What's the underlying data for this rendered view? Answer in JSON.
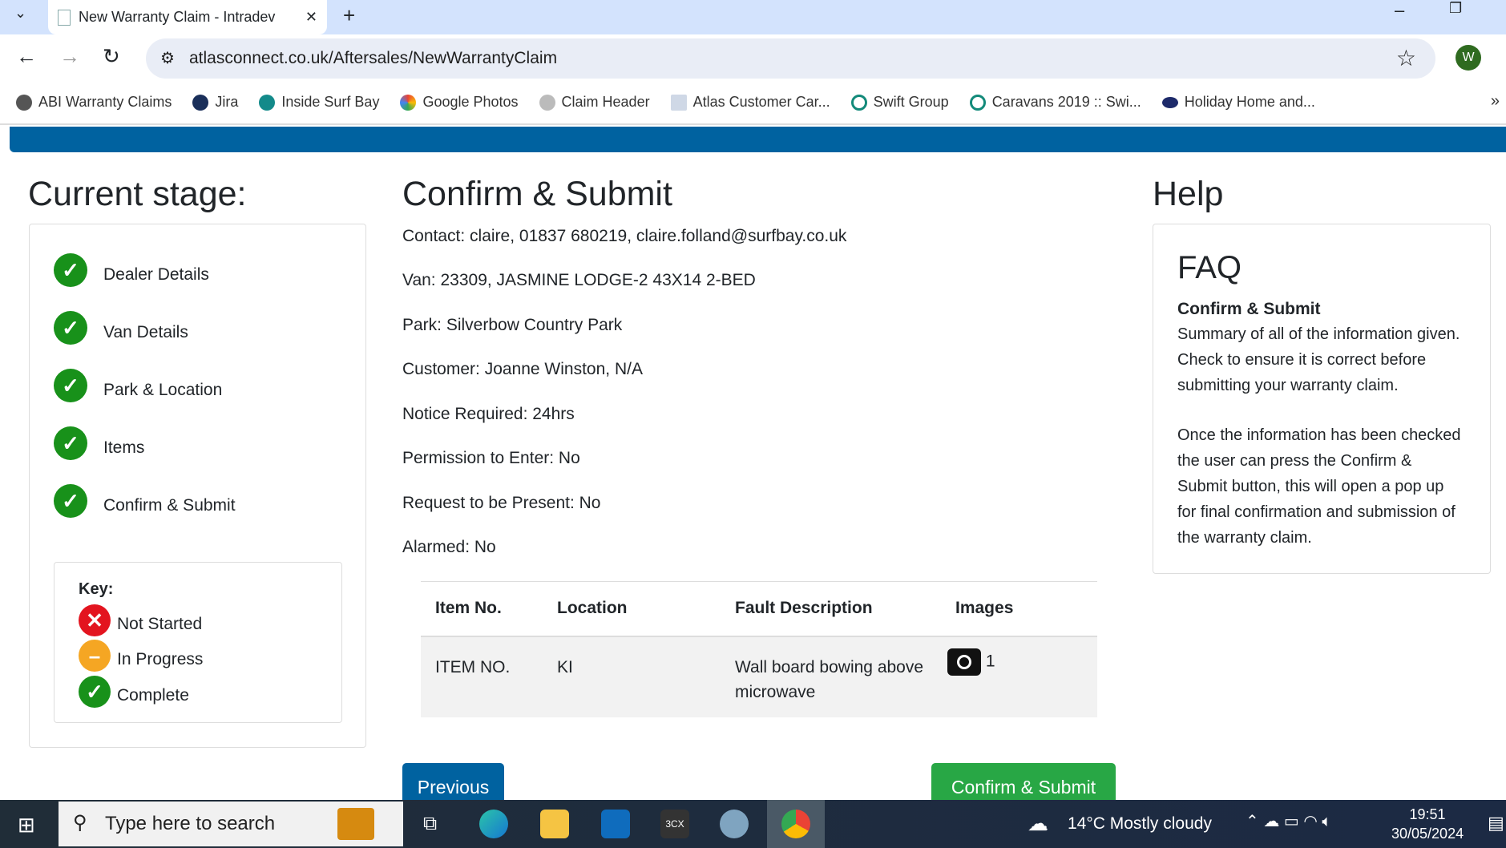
{
  "browser": {
    "tab_title": "New Warranty Claim - Intradev",
    "url": "atlasconnect.co.uk/Aftersales/NewWarrantyClaim",
    "profile_initial": "W",
    "bookmarks": [
      "ABI Warranty Claims",
      "Jira",
      "Inside Surf Bay",
      "Google Photos",
      "Claim Header",
      "Atlas Customer Car...",
      "Swift Group",
      "Caravans 2019 :: Swi...",
      "Holiday Home and..."
    ]
  },
  "stage": {
    "title": "Current stage:",
    "steps": [
      "Dealer Details",
      "Van Details",
      "Park & Location",
      "Items",
      "Confirm & Submit"
    ],
    "key": {
      "title": "Key:",
      "not_started": "Not Started",
      "in_progress": "In Progress",
      "complete": "Complete"
    }
  },
  "main": {
    "title": "Confirm & Submit",
    "lines": [
      "Contact: claire, 01837 680219, claire.folland@surfbay.co.uk",
      "Van: 23309, JASMINE LODGE-2 43X14 2-BED",
      "Park: Silverbow Country Park",
      "Customer: Joanne Winston, N/A",
      "Notice Required: 24hrs",
      "Permission to Enter: No",
      "Request to be Present: No",
      "Alarmed: No"
    ],
    "table": {
      "headers": [
        "Item No.",
        "Location",
        "Fault Description",
        "Images"
      ],
      "rows": [
        {
          "item": "ITEM NO.",
          "location": "KI",
          "fault": "Wall board bowing above microwave",
          "images": "1"
        }
      ]
    },
    "previous": "Previous",
    "confirm": "Confirm & Submit"
  },
  "help": {
    "title": "Help",
    "faq": "FAQ",
    "subtitle": "Confirm & Submit",
    "p1": "Summary of all of the information given. Check to ensure it is correct before submitting your warranty claim.",
    "p2": "Once the information has been checked the user can press the Confirm & Submit button, this will open a pop up for final confirmation and submission of the warranty claim."
  },
  "taskbar": {
    "search": "Type here to search",
    "weather": "14°C  Mostly cloudy",
    "time": "19:51",
    "date": "30/05/2024"
  }
}
